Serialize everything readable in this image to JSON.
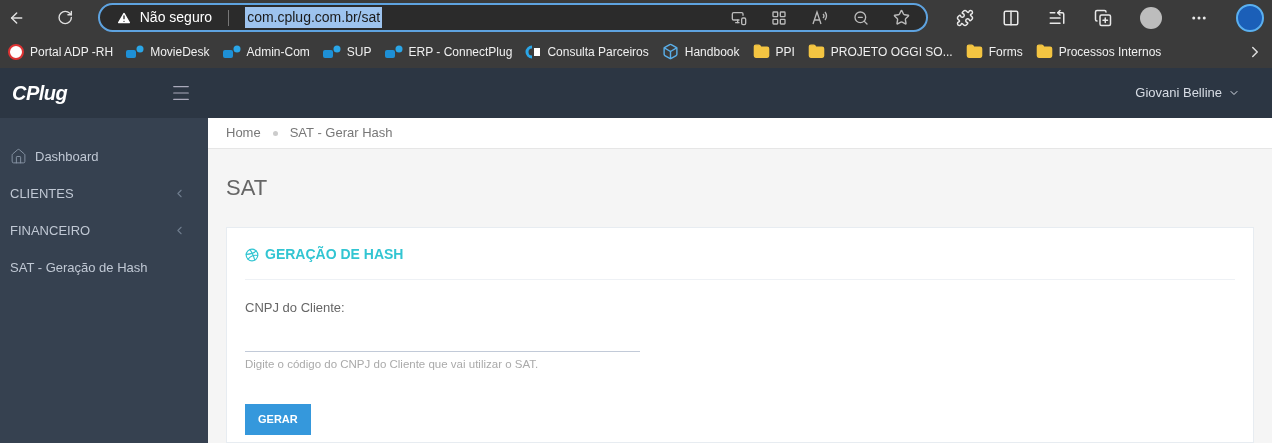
{
  "browser": {
    "security": "Não seguro",
    "url": "com.cplug.com.br/sat"
  },
  "bookmarks": [
    {
      "label": "Portal ADP -RH",
      "kind": "adp"
    },
    {
      "label": "MovieDesk",
      "kind": "plug"
    },
    {
      "label": "Admin-Com",
      "kind": "plug"
    },
    {
      "label": "SUP",
      "kind": "plug"
    },
    {
      "label": "ERP - ConnectPlug",
      "kind": "plug"
    },
    {
      "label": "Consulta Parceiros",
      "kind": "cp"
    },
    {
      "label": "Handbook",
      "kind": "cube"
    },
    {
      "label": "PPI",
      "kind": "folder"
    },
    {
      "label": "PROJETO OGGI SO...",
      "kind": "folder"
    },
    {
      "label": "Forms",
      "kind": "folder"
    },
    {
      "label": "Processos Internos",
      "kind": "folder"
    }
  ],
  "header": {
    "logo": "CPlug",
    "user": "Giovani Belline"
  },
  "sidebar": {
    "items": [
      {
        "label": "Dashboard",
        "kind": "home"
      },
      {
        "label": "CLIENTES",
        "kind": "group"
      },
      {
        "label": "FINANCEIRO",
        "kind": "group"
      },
      {
        "label": "SAT - Geração de Hash",
        "kind": "link"
      }
    ]
  },
  "breadcrumb": [
    "Home",
    "SAT - Gerar Hash"
  ],
  "page_title": "SAT",
  "card": {
    "title": "GERAÇÃO DE HASH",
    "field_label": "CNPJ do Cliente:",
    "help": "Digite o código do CNPJ do Cliente que vai utilizar o SAT.",
    "button": "GERAR"
  }
}
